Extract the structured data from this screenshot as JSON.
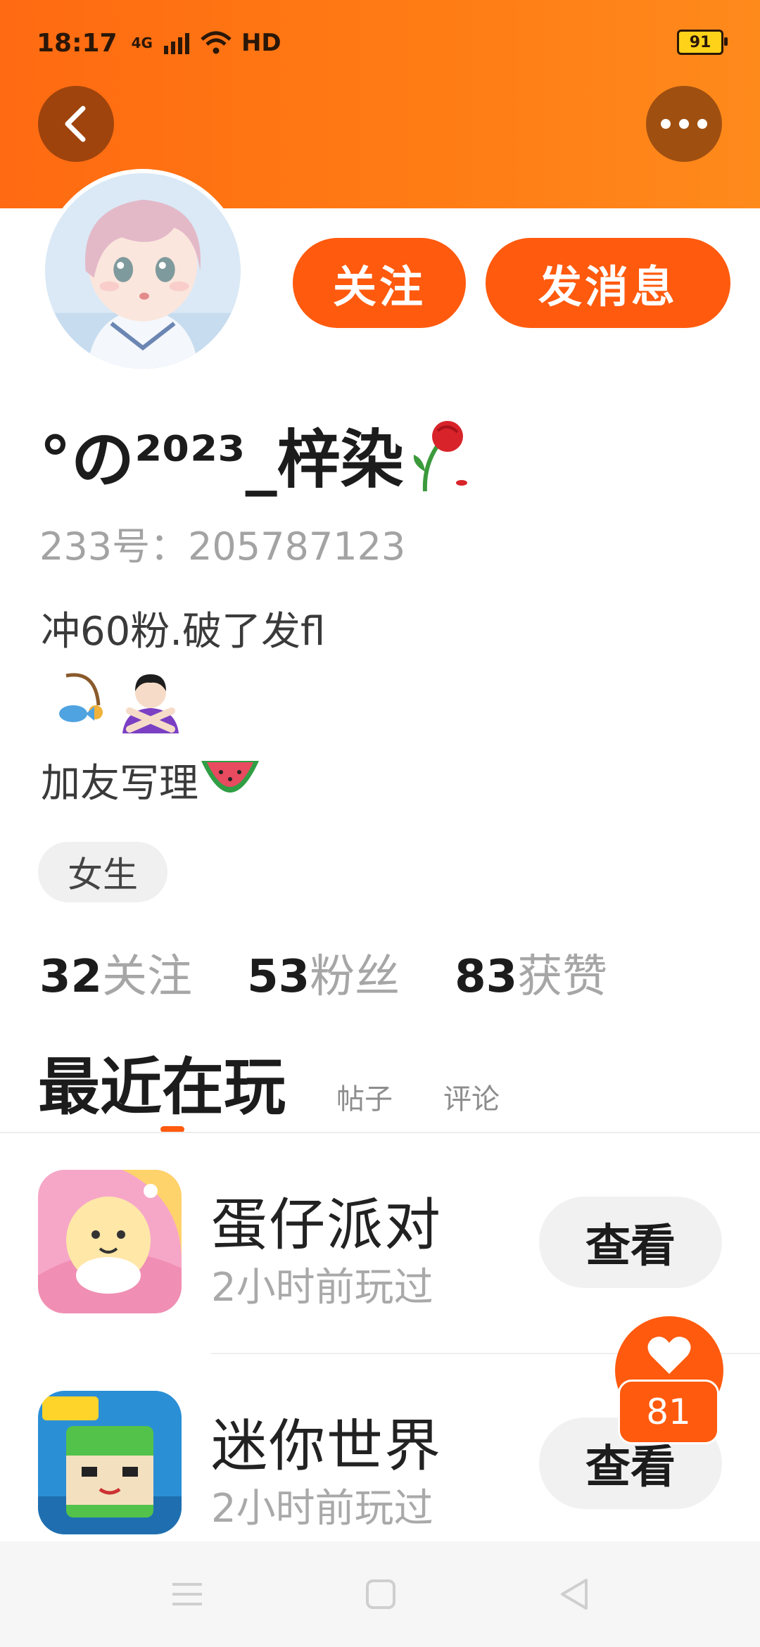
{
  "status_bar": {
    "time": "18:17",
    "network": "4G",
    "hd": "HD",
    "battery": "91"
  },
  "profile": {
    "name": "°の²⁰²³_梓染",
    "uid": "233号：205787123",
    "bio_line1": "冲60粉.破了发fl",
    "bio_line3": "加友写理",
    "tag": "女生"
  },
  "actions": {
    "follow": "关注",
    "message": "发消息"
  },
  "stats": [
    {
      "num": "32",
      "label": "关注"
    },
    {
      "num": "53",
      "label": "粉丝"
    },
    {
      "num": "83",
      "label": "获赞"
    }
  ],
  "tabs": {
    "active": "最近在玩",
    "posts": "帖子",
    "comments": "评论"
  },
  "games": [
    {
      "title": "蛋仔派对",
      "subtitle": "2小时前玩过",
      "button": "查看"
    },
    {
      "title": "迷你世界",
      "subtitle": "2小时前玩过",
      "button": "查看"
    }
  ],
  "like_float": {
    "count": "81"
  },
  "colors": {
    "accent": "#ff5a0e",
    "header_orange": "#ff7b14"
  },
  "icons": [
    "back-icon",
    "more-icon",
    "rose-emoji",
    "fishing-emoji",
    "crossed-arms-emoji",
    "watermelon-emoji",
    "heart-icon",
    "menu-icon",
    "home-icon",
    "back-triangle-icon"
  ]
}
